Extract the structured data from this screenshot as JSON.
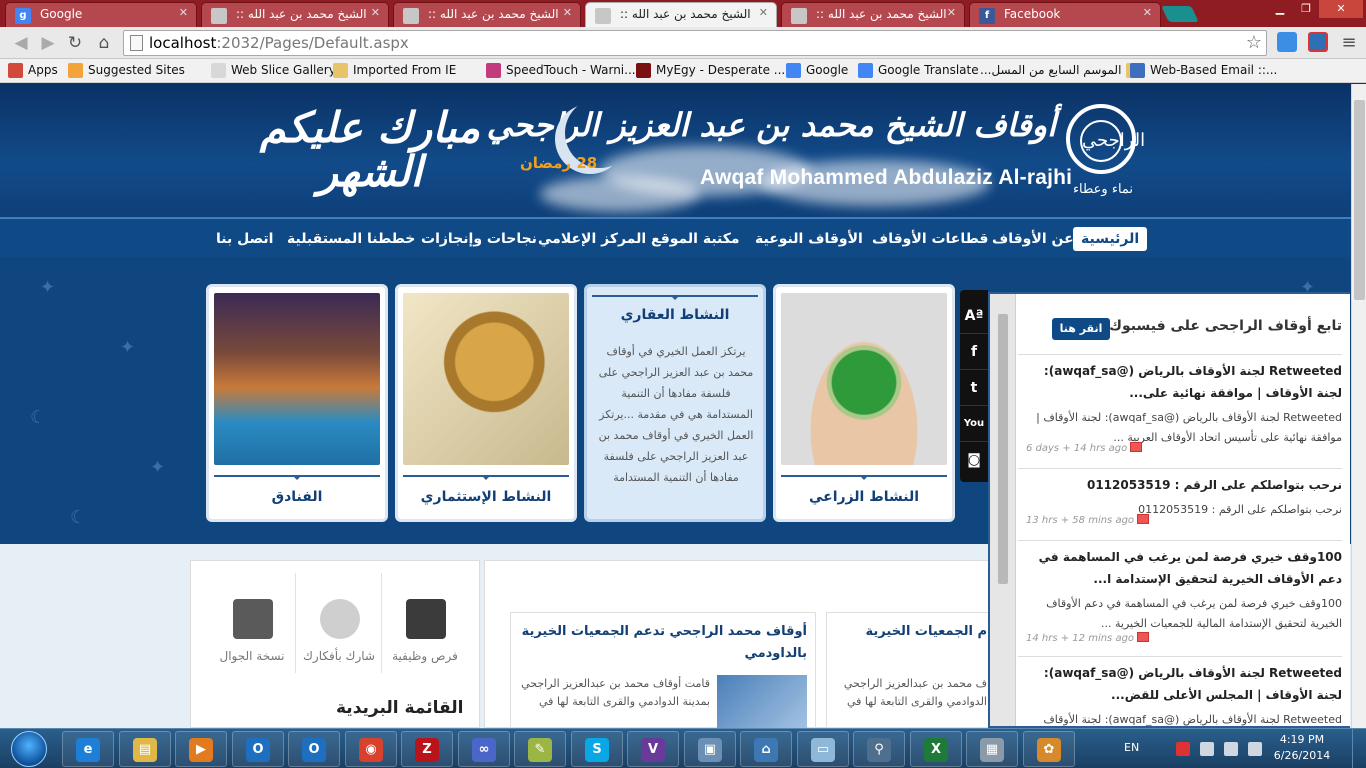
{
  "browser": {
    "tabs": [
      {
        "label": "Google",
        "icon": "google-icon",
        "color": "#4285f4",
        "active": false
      },
      {
        "label": ":: أوقاف الشيخ محمد بن عبد الله",
        "icon": "page-icon",
        "color": "#c7c7c7",
        "active": false
      },
      {
        "label": ":: أوقاف الشيخ محمد بن عبد الله",
        "icon": "page-icon",
        "color": "#c7c7c7",
        "active": false
      },
      {
        "label": ":: أوقاف الشيخ محمد بن عبد الله",
        "icon": "page-icon",
        "color": "#c7c7c7",
        "active": true
      },
      {
        "label": ":: أوقاف الشيخ محمد بن عبد الله",
        "icon": "page-icon",
        "color": "#c7c7c7",
        "active": false
      },
      {
        "label": "Facebook",
        "icon": "facebook-icon",
        "color": "#3b5998",
        "active": false
      }
    ],
    "url_host": "localhost",
    "url_path": ":2032/Pages/Default.aspx",
    "bookmarks": [
      {
        "label": "Apps",
        "icon": "apps-icon",
        "color": "#d24a3a"
      },
      {
        "label": "Suggested Sites",
        "icon": "suggested-sites-icon",
        "color": "#f2a33a"
      },
      {
        "label": "Web Slice Gallery",
        "icon": "page-icon",
        "color": "#d8d8d8"
      },
      {
        "label": "Imported From IE",
        "icon": "folder-icon",
        "color": "#e7c36a"
      },
      {
        "label": "SpeedTouch - Warni...",
        "icon": "speedtouch-icon",
        "color": "#c23b7d"
      },
      {
        "label": "MyEgy - Desperate ...",
        "icon": "myegy-icon",
        "color": "#7a1010"
      },
      {
        "label": "Google",
        "icon": "google-icon",
        "color": "#4285f4"
      },
      {
        "label": "Google Translate",
        "icon": "translate-icon",
        "color": "#4285f4"
      },
      {
        "label": "الموسم السابع من المسل...",
        "icon": "folder-icon",
        "color": "#e7c36a"
      },
      {
        "label": "Web-Based Email ::...",
        "icon": "email-icon",
        "color": "#3f6ebf"
      }
    ]
  },
  "site": {
    "title_ar": "أوقاف الشيخ محمد بن عبد العزيز الراجحي",
    "title_en": "Awqaf Mohammed Abdulaziz Al-rajhi",
    "logo_caption": "نماء وعطاء",
    "logo_mark": "الراجحي",
    "greeting": "مبارك عليكم الشهر",
    "date": "28 رمضان",
    "nav": [
      "الرئيسية",
      "عن الأوقاف",
      "قطاعات الأوقاف",
      "الأوقاف النوعية",
      "مكتبة الموقع",
      "المركز الإعلامي",
      "نجاحات وإنجازات",
      "خططنا المستقبلية",
      "اتصل بنا"
    ],
    "cards": [
      {
        "label": "الفنادق"
      },
      {
        "label": "النشاط الإستثماري"
      },
      {
        "label": "النشاط العقاري",
        "text": "يرتكز العمل الخيري في أوقاف محمد بن عبد العزيز الراجحي على فلسفة مفادها أن التنمية المستدامة هي في مقدمة ...يرتكز العمل الخيري في أوقاف محمد بن عبد العزيز الراجحي على فلسفة مفادها أن التنمية المستدامة"
      },
      {
        "label": "النشاط الزراعي"
      }
    ],
    "quick_links": [
      {
        "label": "فرص وظيفية"
      },
      {
        "label": "شارك بأفكارك"
      },
      {
        "label": "نسخة الجوال"
      }
    ],
    "mailing_list": "القائمة البريدية",
    "news": [
      {
        "title": "أوقاف محمد الراجحي تدعم الجمعيات الخيرية بالداودمي",
        "text": "قامت أوقاف محمد بن عبدالعزيز الراجحي بمدينة الدوادمي والقرى التابعة لها في"
      },
      {
        "title": "م الجمعيات الخيرية",
        "text": "ف محمد بن عبدالعزيز الراجحي الدوادمي والقرى التابعة لها في"
      }
    ]
  },
  "social": {
    "items": [
      {
        "label": "Aª",
        "name": "font-size-icon"
      },
      {
        "label": "f",
        "name": "facebook-icon"
      },
      {
        "label": "t",
        "name": "twitter-icon"
      },
      {
        "label": "You",
        "name": "youtube-icon"
      },
      {
        "label": "◙",
        "name": "instagram-icon"
      }
    ]
  },
  "facebook_panel": {
    "heading": "تابع أوقاف الراجحى على فيسبوك",
    "button": "انقر هنا",
    "posts": [
      {
        "title": "Retweeted لجنة الأوقاف بالرياض (@awqaf_sa): لجنة الأوقاف | موافقة نهائية على...",
        "body": "Retweeted لجنة الأوقاف بالرياض (@awqaf_sa): لجنة الأوقاف | موافقة نهائية على تأسيس اتحاد الأوقاف العربية ...",
        "time": "6 days + 14 hrs ago"
      },
      {
        "title": "نرحب بتواصلكم على الرقم : 0112053519",
        "body": "نرحب بتواصلكم على الرقم : 0112053519",
        "time": "13 hrs + 58 mins ago"
      },
      {
        "title": "100وقف خيري فرصة لمن يرغب في المساهمة في دعم الأوقاف الخيرية لتحقيق الإستدامة ا...",
        "body": "100وقف خيري فرصة لمن يرغب في المساهمة في دعم الأوقاف الخيرية لتحقيق الإستدامة المالية للجمعيات الخيرية ...",
        "time": "14 hrs + 12 mins ago"
      },
      {
        "title": "Retweeted لجنة الأوقاف بالرياض (@awqaf_sa): لجنة الأوقاف | المجلس الأعلى للقض...",
        "body": "Retweeted لجنة الأوقاف بالرياض (@awqaf_sa): لجنة الأوقاف",
        "time": ""
      }
    ]
  },
  "taskbar": {
    "apps": [
      {
        "name": "internet-explorer-icon",
        "glyph": "e",
        "color": "#1e7fd8"
      },
      {
        "name": "file-explorer-icon",
        "glyph": "▤",
        "color": "#e0b84a"
      },
      {
        "name": "media-player-icon",
        "glyph": "▶",
        "color": "#e27a1f"
      },
      {
        "name": "outlook-icon",
        "glyph": "O",
        "color": "#1f6fc1"
      },
      {
        "name": "outlook-icon",
        "glyph": "O",
        "color": "#1f6fc1"
      },
      {
        "name": "chrome-icon",
        "glyph": "◉",
        "color": "#d9412f"
      },
      {
        "name": "filezilla-icon",
        "glyph": "Z",
        "color": "#b8141a"
      },
      {
        "name": "infinity-app-icon",
        "glyph": "∞",
        "color": "#4a66c8"
      },
      {
        "name": "tools-icon",
        "glyph": "✎",
        "color": "#9cb645"
      },
      {
        "name": "skype-icon",
        "glyph": "S",
        "color": "#0aa7e6"
      },
      {
        "name": "visual-studio-icon",
        "glyph": "V",
        "color": "#6a3a9a"
      },
      {
        "name": "remote-desktop-icon",
        "glyph": "▣",
        "color": "#6b8fb5"
      },
      {
        "name": "network-icon",
        "glyph": "⌂",
        "color": "#3d78b4"
      },
      {
        "name": "notepad-icon",
        "glyph": "▭",
        "color": "#8fb8d8"
      },
      {
        "name": "search-tool-icon",
        "glyph": "⚲",
        "color": "#4f6f8f"
      },
      {
        "name": "excel-icon",
        "glyph": "X",
        "color": "#1f7a3a"
      },
      {
        "name": "calculator-icon",
        "glyph": "▦",
        "color": "#8a9aa8"
      },
      {
        "name": "paint-icon",
        "glyph": "✿",
        "color": "#d78a2b"
      }
    ],
    "lang": "EN",
    "time": "4:19 PM",
    "date": "6/26/2014"
  }
}
